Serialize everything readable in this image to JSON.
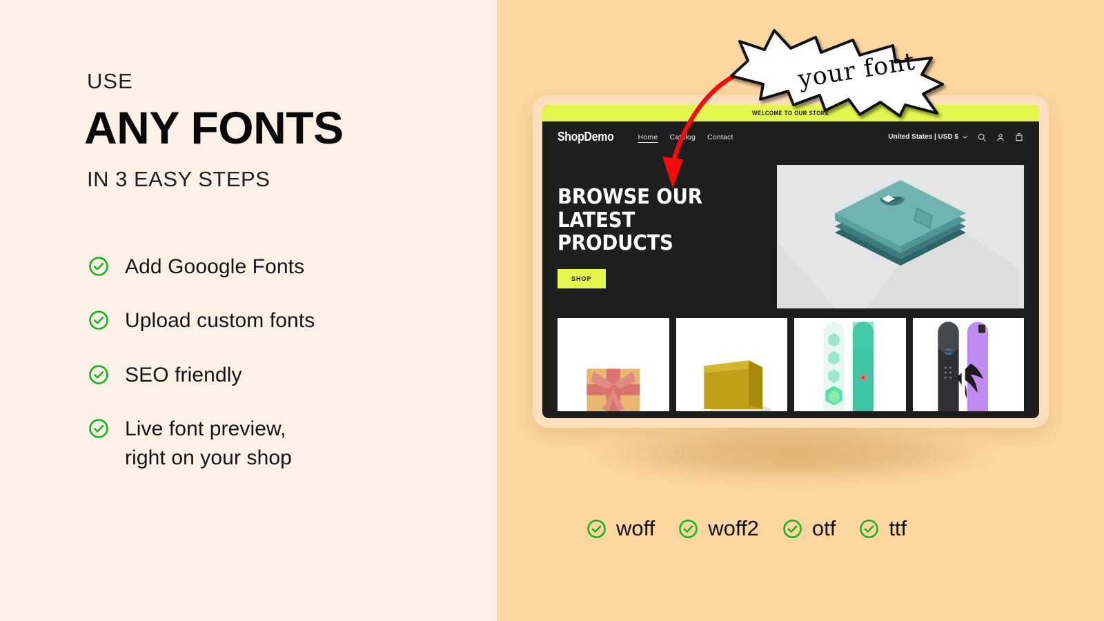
{
  "colors": {
    "left_bg": "#FDF1E7",
    "right_bg": "#FDD6A0",
    "check_green": "#16B520",
    "accent_lime": "#E3F64E",
    "arrow_red": "#F40C0C",
    "mockup_dark": "#1E1E1E",
    "mockup_frame": "#FBDFBC"
  },
  "left": {
    "eyebrow": "USE",
    "headline": "ANY FONTS",
    "subhead": "IN 3 EASY STEPS",
    "features": [
      {
        "icon": "check-circle-icon",
        "label": "Add Gooogle Fonts"
      },
      {
        "icon": "check-circle-icon",
        "label": "Upload custom fonts"
      },
      {
        "icon": "check-circle-icon",
        "label": "SEO friendly"
      },
      {
        "icon": "check-circle-icon",
        "label": "Live font preview,\nright on your shop"
      }
    ]
  },
  "callout": {
    "text": "your font",
    "shape": "starburst-speech-bubble",
    "arrow": "curved-arrow-icon"
  },
  "mockup": {
    "announcement": "WELCOME TO OUR STORE",
    "logo": "ShopDemo",
    "nav_links": [
      {
        "label": "Home",
        "active": true
      },
      {
        "label": "Catalog",
        "active": false
      },
      {
        "label": "Contact",
        "active": false
      }
    ],
    "locale": "United States | USD $",
    "locale_chevron": "chevron-down-icon",
    "nav_icons": [
      "search-icon",
      "account-icon",
      "cart-icon"
    ],
    "hero": {
      "heading_line1": "BROWSE OUR",
      "heading_line2": "LATEST PRODUCTS",
      "button_label": "SHOP",
      "image_alt": "folded-tshirt-stack-illustration"
    },
    "products": [
      {
        "name": "gift-box-product"
      },
      {
        "name": "soap-bar-product"
      },
      {
        "name": "teal-snowboards-product"
      },
      {
        "name": "dark-purple-snowboards-product"
      }
    ]
  },
  "formats": [
    {
      "icon": "check-circle-icon",
      "label": "woff"
    },
    {
      "icon": "check-circle-icon",
      "label": "woff2"
    },
    {
      "icon": "check-circle-icon",
      "label": "otf"
    },
    {
      "icon": "check-circle-icon",
      "label": "ttf"
    }
  ]
}
